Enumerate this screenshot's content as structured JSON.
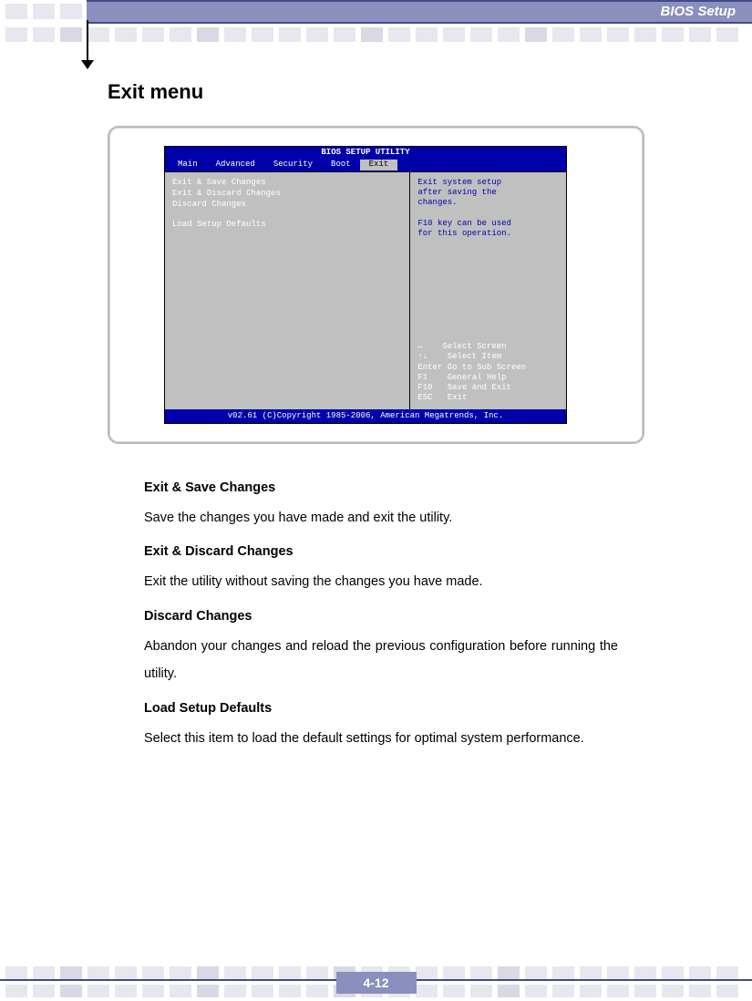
{
  "header": {
    "title": "BIOS Setup"
  },
  "section_title": "Exit menu",
  "bios": {
    "utility_title": "BIOS SETUP UTILITY",
    "tabs": [
      "Main",
      "Advanced",
      "Security",
      "Boot",
      "Exit"
    ],
    "active_tab": "Exit",
    "menu_items": [
      "Exit & Save Changes",
      "Exit & Discard Changes",
      "Discard Changes",
      "",
      "Load Setup Defaults"
    ],
    "help_text": "Exit system setup\nafter saving the\nchanges.\n\nF10 key can be used\nfor this operation.",
    "key_legend": "↔    Select Screen\n↑↓    Select Item\nEnter Go to Sub Screen\nF1    General Help\nF10   Save and Exit\nESC   Exit",
    "footer": "v02.61 (C)Copyright 1985-2006, American Megatrends, Inc."
  },
  "descriptions": [
    {
      "heading": "Exit & Save Changes",
      "body": "Save the changes you have made and exit the utility."
    },
    {
      "heading": "Exit & Discard Changes",
      "body": "Exit the utility without saving the changes you have made."
    },
    {
      "heading": "Discard Changes",
      "body": "Abandon your changes and reload the previous configuration before running the utility."
    },
    {
      "heading": "Load Setup Defaults",
      "body": "Select this item to load the default settings for optimal system performance."
    }
  ],
  "page_number": "4-12"
}
